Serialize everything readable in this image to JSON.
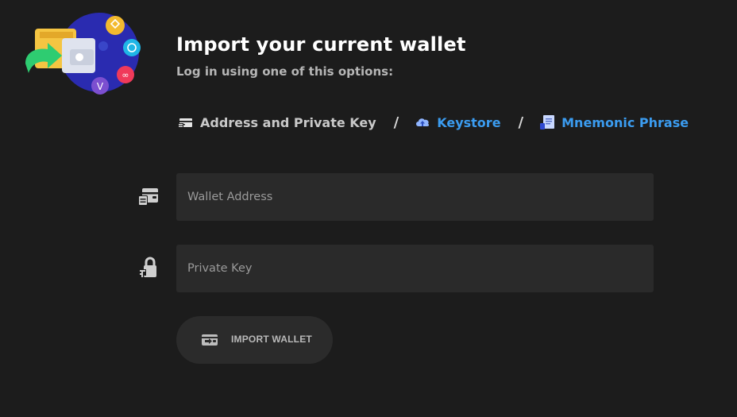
{
  "header": {
    "title": "Import your current wallet",
    "subtitle": "Log in using one of this options:"
  },
  "options": [
    {
      "label": "Address and Private Key",
      "icon": "card-key-icon",
      "active": true
    },
    {
      "label": "Keystore",
      "icon": "cloud-upload-icon",
      "active": false
    },
    {
      "label": "Mnemonic Phrase",
      "icon": "document-icon",
      "active": false
    }
  ],
  "separator": "/",
  "form": {
    "wallet_address": {
      "placeholder": "Wallet Address",
      "value": "",
      "icon": "wallet-icon"
    },
    "private_key": {
      "placeholder": "Private Key",
      "value": "",
      "icon": "lock-key-icon"
    }
  },
  "import_button": {
    "label": "IMPORT WALLET",
    "icon": "wallet-import-icon"
  },
  "colors": {
    "background": "#1c1c1c",
    "input_background": "#2a2a2a",
    "link": "#3b9cf0",
    "hero_circle": "#2a2bb0",
    "hero_arrow": "#2ecc71",
    "hero_wallet": "#f5c542"
  }
}
